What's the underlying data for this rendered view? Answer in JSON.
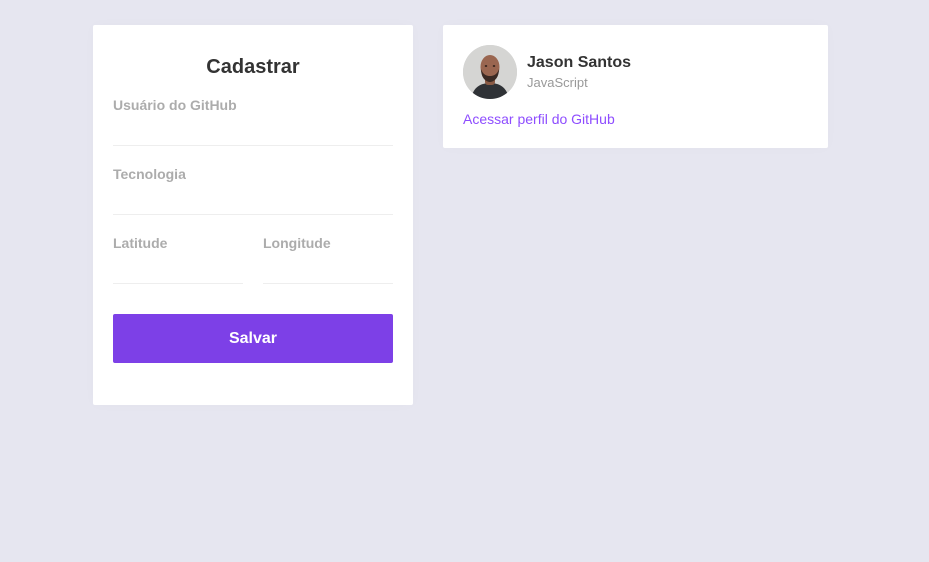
{
  "form": {
    "title": "Cadastrar",
    "github_username": {
      "label": "Usuário do GitHub",
      "value": ""
    },
    "techs": {
      "label": "Tecnologia",
      "value": ""
    },
    "latitude": {
      "label": "Latitude",
      "value": ""
    },
    "longitude": {
      "label": "Longitude",
      "value": ""
    },
    "save_label": "Salvar"
  },
  "dev": {
    "name": "Jason Santos",
    "techs": "JavaScript",
    "profile_link_label": "Acessar perfil do GitHub"
  },
  "colors": {
    "background": "#e6e6f0",
    "primary": "#7d40e7",
    "link": "#8e4dff",
    "label": "#acacac"
  }
}
